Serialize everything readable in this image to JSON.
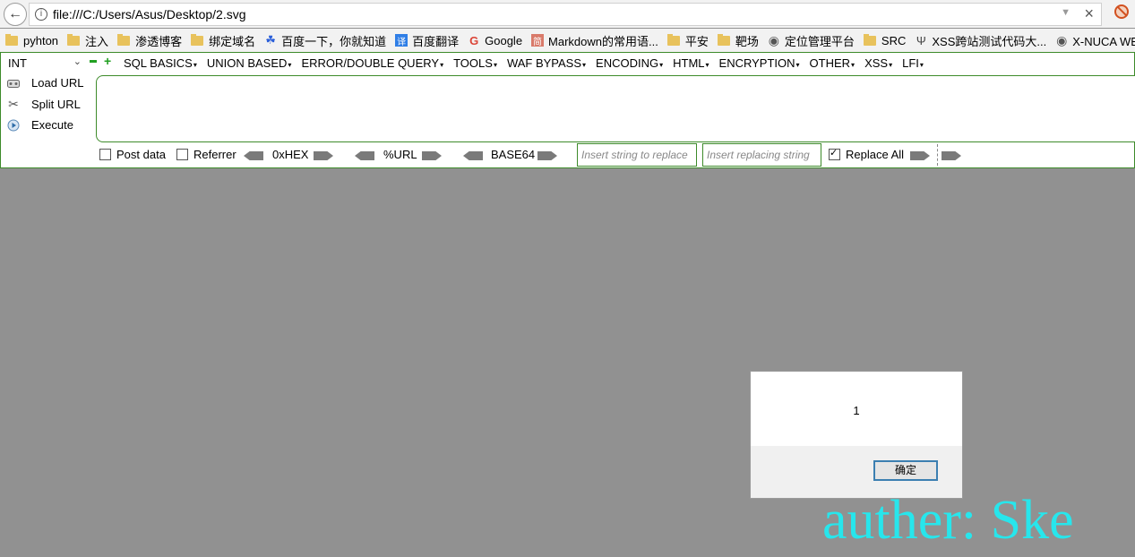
{
  "address_bar": {
    "url": "file:///C:/Users/Asus/Desktop/2.svg"
  },
  "bookmarks": [
    {
      "label": "pyhton",
      "icon": "folder-icon"
    },
    {
      "label": "注入",
      "icon": "folder-icon"
    },
    {
      "label": "渗透博客",
      "icon": "folder-icon"
    },
    {
      "label": "绑定域名",
      "icon": "folder-icon"
    },
    {
      "label": "百度一下，你就知道",
      "icon": "baidu-icon"
    },
    {
      "label": "百度翻译",
      "icon": "translate-icon"
    },
    {
      "label": "Google",
      "icon": "google-icon"
    },
    {
      "label": "Markdown的常用语...",
      "icon": "markdown-icon"
    },
    {
      "label": "平安",
      "icon": "folder-icon"
    },
    {
      "label": "靶场",
      "icon": "folder-icon"
    },
    {
      "label": "定位管理平台",
      "icon": "globe-icon"
    },
    {
      "label": "SRC",
      "icon": "folder-icon"
    },
    {
      "label": "XSS跨站测试代码大...",
      "icon": "xss-icon"
    },
    {
      "label": "X-NUCA WEB专题赛",
      "icon": "globe-icon"
    }
  ],
  "hackbar": {
    "select_value": "INT",
    "menus": [
      "SQL BASICS",
      "UNION BASED",
      "ERROR/DOUBLE QUERY",
      "TOOLS",
      "WAF BYPASS",
      "ENCODING",
      "HTML",
      "ENCRYPTION",
      "OTHER",
      "XSS",
      "LFI"
    ],
    "load_url": "Load URL",
    "split_url": "Split URL",
    "execute": "Execute",
    "post_data": "Post data",
    "referrer": "Referrer",
    "hex": "0xHEX",
    "url_enc": "%URL",
    "base64": "BASE64",
    "replace_placeholder": "Insert string to replace",
    "replacing_placeholder": "Insert replacing string",
    "replace_all": "Replace All"
  },
  "dialog": {
    "message": "1",
    "ok_button": "确定"
  },
  "watermark": "auther: Ske",
  "colors": {
    "page_background": "#919191",
    "hackbar_border": "#3d8b2a",
    "watermark": "#27e6ec"
  }
}
